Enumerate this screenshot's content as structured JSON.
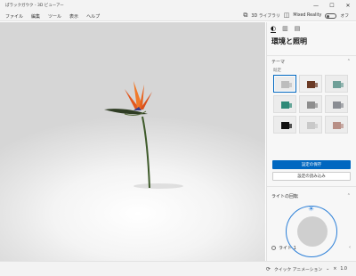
{
  "titlebar": {
    "title": "ぱラックガウク - 3D ビューアー",
    "minimize": "—",
    "maximize": "☐",
    "close": "✕"
  },
  "menu": {
    "items": [
      "ファイル",
      "編集",
      "ツール",
      "表示",
      "ヘルプ"
    ]
  },
  "toolbar_right": {
    "library_label": "3D ライブラリ",
    "mixed_reality_label": "Mixed Reality",
    "toggle_state": "オフ"
  },
  "panel": {
    "tabs": [
      "◐",
      "▥",
      "▤"
    ],
    "title": "環境と照明",
    "theme_section": "テーマ",
    "theme_sub": "既定",
    "save_button": "設定の保存",
    "load_button": "設定の読み込み",
    "light_rotation_section": "ライトの回転",
    "light1_label": "ライト 1"
  },
  "themes": [
    {
      "bg": "#ececec",
      "cube": "#bdbdbd",
      "selected": true
    },
    {
      "bg": "#f0f0f0",
      "cube": "#6b3b26",
      "selected": false
    },
    {
      "bg": "#ececec",
      "cube": "#6f9f98",
      "selected": false
    },
    {
      "bg": "#ececec",
      "cube": "#2f8a78",
      "selected": false
    },
    {
      "bg": "#ececec",
      "cube": "#8e8e8e",
      "selected": false
    },
    {
      "bg": "#ececec",
      "cube": "#8a8d93",
      "selected": false
    },
    {
      "bg": "#ececec",
      "cube": "#111111",
      "selected": false
    },
    {
      "bg": "#ececec",
      "cube": "#c9c9c9",
      "selected": false
    },
    {
      "bg": "#ececec",
      "cube": "#b88f86",
      "selected": false
    }
  ],
  "status": {
    "quick_animation": "クイック アニメーション",
    "zoom_label": "×",
    "zoom_value": "1.0"
  },
  "colors": {
    "accent": "#0067c0",
    "ring": "#2b7fd8"
  }
}
